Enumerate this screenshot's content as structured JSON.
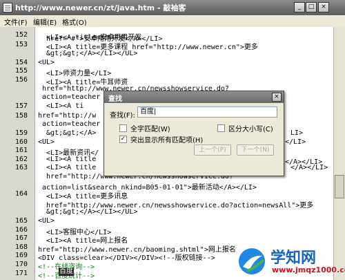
{
  "window": {
    "title": "http://www.newer.cn/zt/java.htm - 敲袖客"
  },
  "menu": [
    "文件(F)",
    "编辑(E)",
    "格式(O)"
  ],
  "code_lines": [
    {
      "ln": "152",
      "text": "  <LI><A title=安卓用用开发"
    },
    {
      "ln": "",
      "text": "  href=\"#\">安卓用用开发</A></LI>"
    },
    {
      "ln": "153",
      "text": "  <LI><A title=更多课程 href=\"http://www.newer.cn\">更多"
    },
    {
      "ln": "",
      "text": "  &gt;&gt;</A></LI></UL>"
    },
    {
      "ln": "154",
      "text": "<UL>"
    },
    {
      "ln": "155",
      "text": "  <LI>师资力量</LI>"
    },
    {
      "ln": "156",
      "text": "  <LI><A title=牛耳师资"
    },
    {
      "ln": "",
      "text": " href=\"http://www.newer.cn/newsshowservice.do?"
    },
    {
      "ln": "",
      "text": " action=teacher"
    },
    {
      "ln": "157",
      "text": "  <LI><A ti"
    },
    {
      "ln": "158",
      "text": "href=\"http://w"
    },
    {
      "ln": "",
      "text": " action=teacher"
    },
    {
      "ln": "159",
      "text": "  &gt;&gt;</A>"
    },
    {
      "ln": "160",
      "text": "<UL>"
    },
    {
      "ln": "161",
      "text": "  <LI>最新资讯</"
    },
    {
      "ln": "162",
      "text": "  <LI><A title"
    },
    {
      "ln": "163",
      "text": "  <LI><A title"
    },
    {
      "ln": "",
      "text": "  href=\"http://www.newer.cn/newsshowservice.do?"
    },
    {
      "ln": "",
      "text": " action=list&search_nkind=B05-01-01\">最新活动</A></LI>"
    },
    {
      "ln": "164",
      "text": "  <LI><A title=更多讯息"
    },
    {
      "ln": "",
      "text": "  href=\"http://www.newer.cn/newsshowservice.do?action=newsAll\">更多"
    },
    {
      "ln": "",
      "text": "  &gt;&gt;</A></LI></UL>"
    },
    {
      "ln": "165",
      "text": "<UL>"
    },
    {
      "ln": "166",
      "text": "  <LI>客服中心</LI>"
    },
    {
      "ln": "167",
      "text": "  <LI><A title=网上报名"
    },
    {
      "ln": "168",
      "text": "href=\"http://www.newer.cn/baoming.shtml\">网上报名"
    },
    {
      "ln": "169",
      "text": "<DIV class=clear></DIV></DIV><!--版权链接-->"
    },
    {
      "ln": "170",
      "text": "<!--在线咨询-->"
    },
    {
      "ln": "171",
      "text": "<!--百度统计-->"
    }
  ],
  "code_right_fragments": [
    {
      "text": "LI>"
    },
    {
      "text": "</LI>"
    },
    {
      "text": "息</A></LI>"
    },
    {
      "text": "</A></LI>"
    }
  ],
  "highlight_text": "百度",
  "find_dialog": {
    "title": "查找",
    "close_label": "×",
    "find_label": "查找(F):",
    "find_value": "百度|",
    "options": [
      {
        "label": "全字匹配(W)",
        "checked": false
      },
      {
        "label": "区分大小写(C)",
        "checked": false
      },
      {
        "label": "突出显示所有匹配项(H)",
        "checked": true
      }
    ],
    "prev_button": "上一个(P)",
    "next_button": "下一个(N)"
  },
  "watermark": {
    "title": "学知网",
    "url": "www.jmqz1000.com"
  },
  "colors": {
    "comment": "#008000",
    "watermark_blue": "#1565c0",
    "watermark_red": "#c8101e"
  }
}
